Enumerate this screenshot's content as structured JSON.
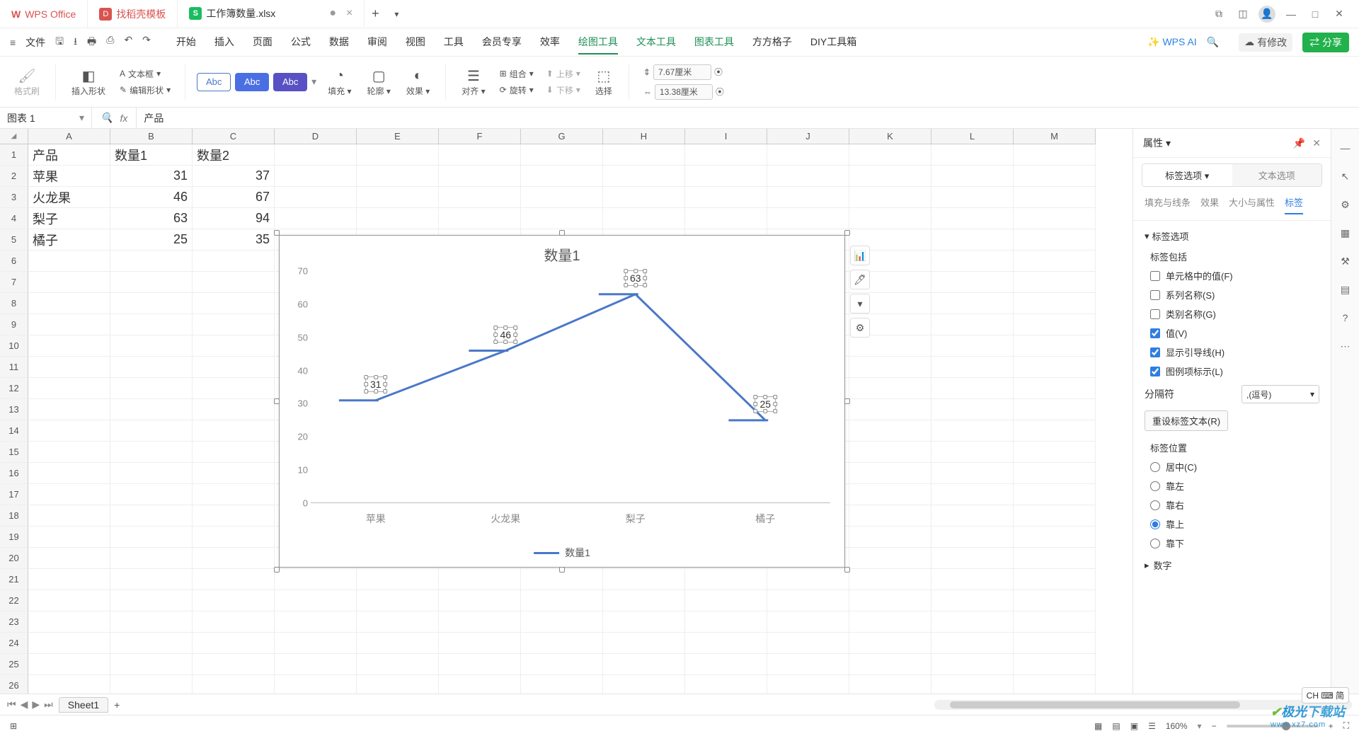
{
  "titlebar": {
    "tabs": [
      {
        "label": "WPS Office",
        "type": "wps"
      },
      {
        "label": "找稻壳模板",
        "type": "template"
      },
      {
        "label": "工作簿数量.xlsx",
        "type": "sheet"
      }
    ]
  },
  "menubar": {
    "file": "文件",
    "tabs": [
      "开始",
      "插入",
      "页面",
      "公式",
      "数据",
      "审阅",
      "视图",
      "工具",
      "会员专享",
      "效率",
      "绘图工具",
      "文本工具",
      "图表工具",
      "方方格子",
      "DIY工具箱"
    ],
    "wps_ai": "WPS AI",
    "modified": "有修改",
    "share": "分享"
  },
  "ribbon": {
    "format_brush": "格式刷",
    "insert_shape": "插入形状",
    "text_box": "文本框",
    "edit_shape": "编辑形状",
    "fill": "填充",
    "outline": "轮廓",
    "effect": "效果",
    "align": "对齐",
    "group": "组合",
    "rotate": "旋转",
    "up": "上移",
    "down": "下移",
    "select": "选择",
    "h": "7.67厘米",
    "w": "13.38厘米"
  },
  "formula_bar": {
    "name_box": "图表 1",
    "formula": "产品"
  },
  "columns": [
    "A",
    "B",
    "C",
    "D",
    "E",
    "F",
    "G",
    "H",
    "I",
    "J",
    "K",
    "L",
    "M"
  ],
  "table": {
    "headers": [
      "产品",
      "数量1",
      "数量2"
    ],
    "rows": [
      [
        "苹果",
        31,
        37
      ],
      [
        "火龙果",
        46,
        67
      ],
      [
        "梨子",
        63,
        94
      ],
      [
        "橘子",
        25,
        35
      ]
    ]
  },
  "chart_data": {
    "type": "line",
    "title": "数量1",
    "categories": [
      "苹果",
      "火龙果",
      "梨子",
      "橘子"
    ],
    "series": [
      {
        "name": "数量1",
        "values": [
          31,
          46,
          63,
          25
        ]
      }
    ],
    "ylim": [
      0,
      70
    ],
    "yticks": [
      0,
      10,
      20,
      30,
      40,
      50,
      60,
      70
    ],
    "legend": "数量1",
    "data_labels": [
      31,
      46,
      63,
      25
    ]
  },
  "props": {
    "title": "属性",
    "sub_tabs": {
      "active": "标签选项",
      "other": "文本选项"
    },
    "nav": [
      "填充与线条",
      "效果",
      "大小与属性",
      "标签"
    ],
    "section_labels": "标签选项",
    "labels_include": "标签包括",
    "checks": {
      "cell_value": {
        "label": "单元格中的值(F)",
        "checked": false
      },
      "series_name": {
        "label": "系列名称(S)",
        "checked": false
      },
      "category_name": {
        "label": "类别名称(G)",
        "checked": false
      },
      "value": {
        "label": "值(V)",
        "checked": true
      },
      "leader_lines": {
        "label": "显示引导线(H)",
        "checked": true
      },
      "legend_key": {
        "label": "图例项标示(L)",
        "checked": true
      }
    },
    "separator": {
      "label": "分隔符",
      "value": ",(逗号)"
    },
    "reset": "重设标签文本(R)",
    "position_label": "标签位置",
    "positions": {
      "center": "居中(C)",
      "left": "靠左",
      "right": "靠右",
      "top": "靠上",
      "bottom": "靠下"
    },
    "selected_position": "top",
    "number_section": "数字"
  },
  "sheet_bar": {
    "sheet": "Sheet1"
  },
  "status": {
    "zoom": "160%",
    "ime": "CH ⌨ 简"
  },
  "watermark": {
    "line1_prefix": "极光",
    "line1_suffix": "下载站",
    "line2": "www.xz7.com"
  }
}
